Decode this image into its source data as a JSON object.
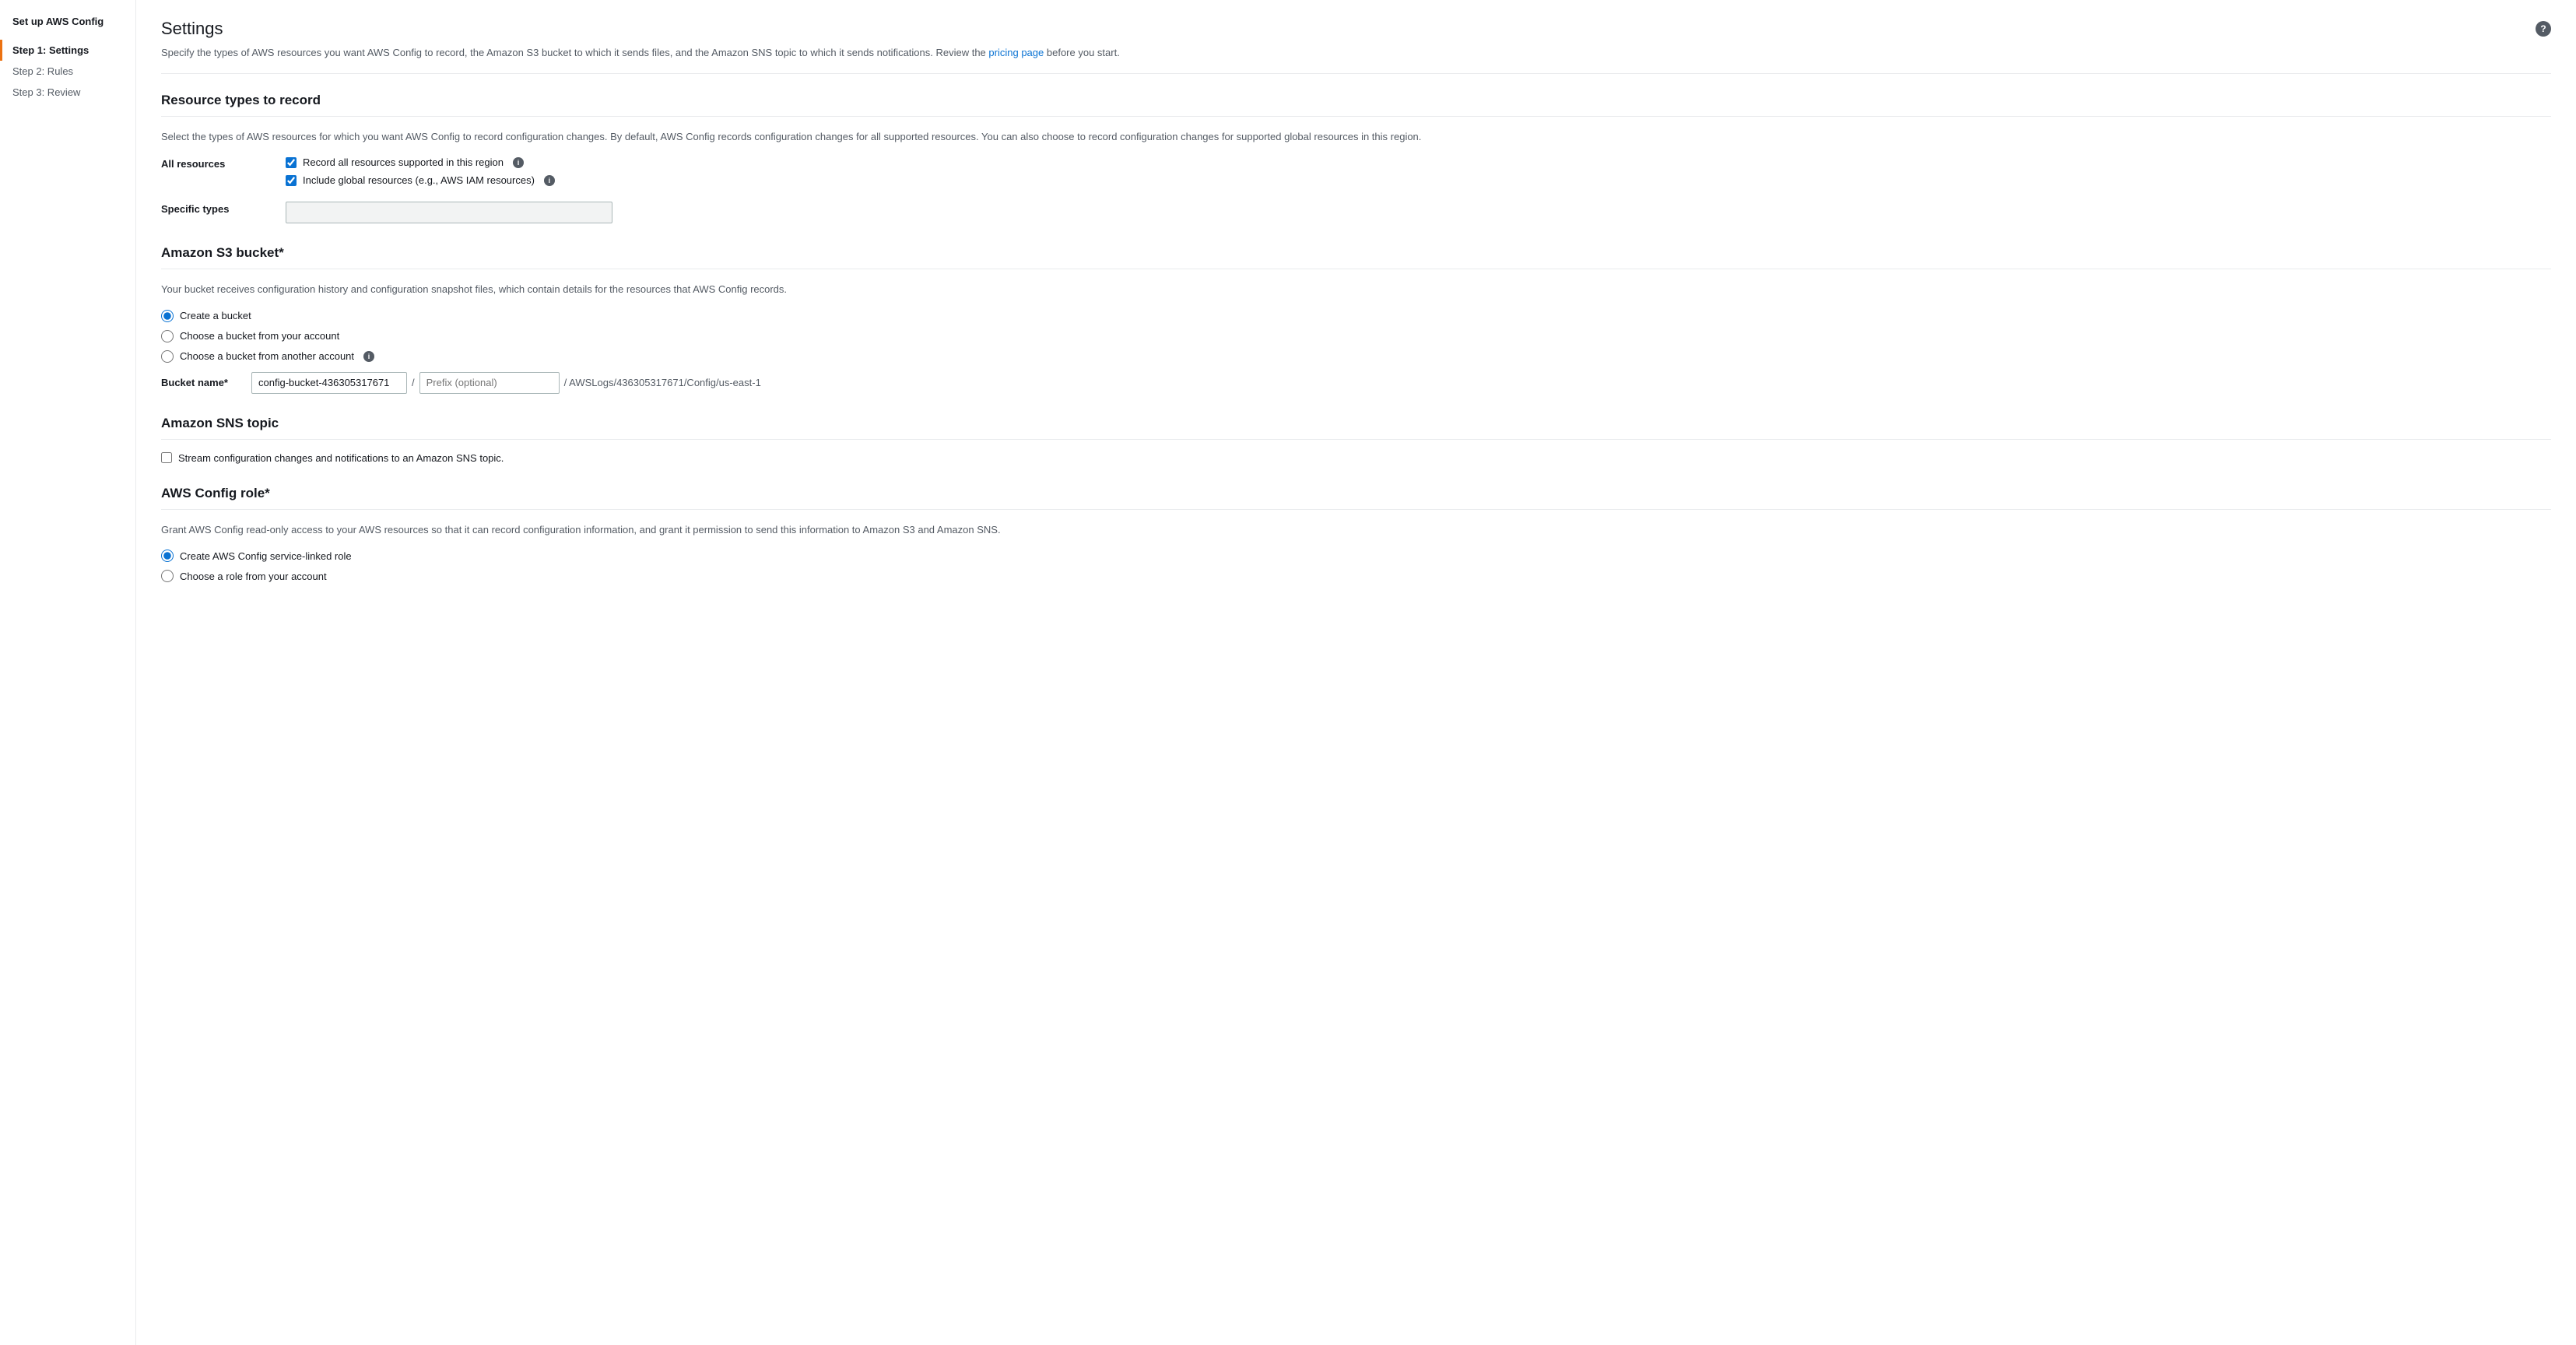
{
  "sidebar": {
    "header": "Set up AWS Config",
    "items": [
      {
        "id": "step1",
        "label": "Step 1: Settings",
        "active": true
      },
      {
        "id": "step2",
        "label": "Step 2: Rules",
        "active": false
      },
      {
        "id": "step3",
        "label": "Step 3: Review",
        "active": false
      }
    ]
  },
  "page": {
    "title": "Settings",
    "description": "Specify the types of AWS resources you want AWS Config to record, the Amazon S3 bucket to which it sends files, and the Amazon SNS topic to which it sends notifications. Review the",
    "description_link_text": "pricing page",
    "description_suffix": "before you start."
  },
  "resource_section": {
    "title": "Resource types to record",
    "description": "Select the types of AWS resources for which you want AWS Config to record configuration changes. By default, AWS Config records configuration changes for all supported resources. You can also choose to record configuration changes for supported global resources in this region.",
    "all_resources_label": "All resources",
    "checkbox_record_label": "Record all resources supported in this region",
    "checkbox_global_label": "Include global resources (e.g., AWS IAM resources)",
    "specific_types_label": "Specific types",
    "specific_types_placeholder": ""
  },
  "s3_section": {
    "title": "Amazon S3 bucket*",
    "description": "Your bucket receives configuration history and configuration snapshot files, which contain details for the resources that AWS Config records.",
    "options": [
      {
        "id": "create",
        "label": "Create a bucket",
        "selected": true
      },
      {
        "id": "choose-own",
        "label": "Choose a bucket from your account",
        "selected": false
      },
      {
        "id": "choose-other",
        "label": "Choose a bucket from another account",
        "selected": false
      }
    ],
    "bucket_name_label": "Bucket name*",
    "bucket_name_value": "config-bucket-436305317671",
    "prefix_placeholder": "Prefix (optional)",
    "bucket_suffix": "/ AWSLogs/436305317671/Config/us-east-1"
  },
  "sns_section": {
    "title": "Amazon SNS topic",
    "checkbox_label": "Stream configuration changes and notifications to an Amazon SNS topic."
  },
  "role_section": {
    "title": "AWS Config role*",
    "description": "Grant AWS Config read-only access to your AWS resources so that it can record configuration information, and grant it permission to send this information to Amazon S3 and Amazon SNS.",
    "options": [
      {
        "id": "create-role",
        "label": "Create AWS Config service-linked role",
        "selected": true
      },
      {
        "id": "choose-role",
        "label": "Choose a role from your account",
        "selected": false
      }
    ]
  }
}
